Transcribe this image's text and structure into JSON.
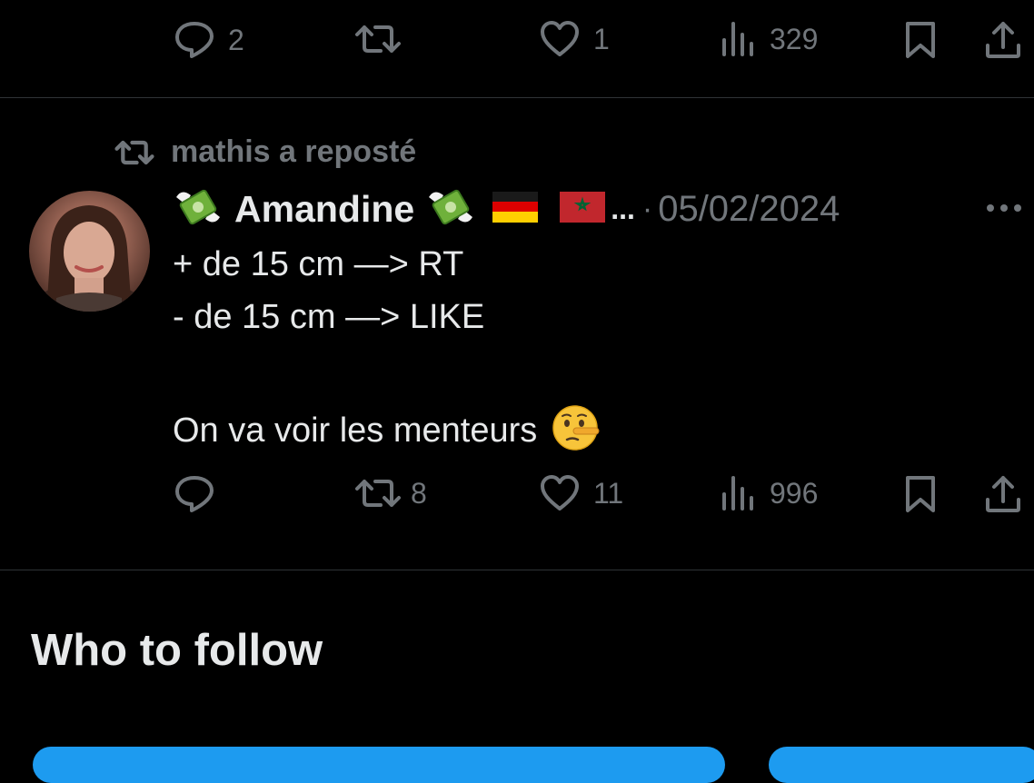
{
  "top_actions": {
    "replies": "2",
    "reposts": "",
    "likes": "1",
    "views": "329"
  },
  "tweet": {
    "repost_label": "mathis a reposté",
    "author_name": "Amandine",
    "name_ellipsis": "...",
    "separator": "·",
    "date": "05/02/2024",
    "lines": [
      "+ de 15 cm —> RT",
      "- de 15 cm —> LIKE",
      "On va voir les menteurs"
    ],
    "actions": {
      "replies": "",
      "reposts": "8",
      "likes": "11",
      "views": "996"
    }
  },
  "section": {
    "who_to_follow": "Who to follow"
  },
  "colors": {
    "background": "#000000",
    "text": "#e7e9ea",
    "muted": "#71767b",
    "divider": "#2f3336",
    "accent": "#1d9bf0"
  },
  "icons": [
    "reply-icon",
    "repost-icon",
    "like-icon",
    "views-icon",
    "bookmark-icon",
    "share-icon",
    "more-icon",
    "money-wings-emoji",
    "germany-flag",
    "morocco-flag",
    "lying-face-emoji"
  ]
}
